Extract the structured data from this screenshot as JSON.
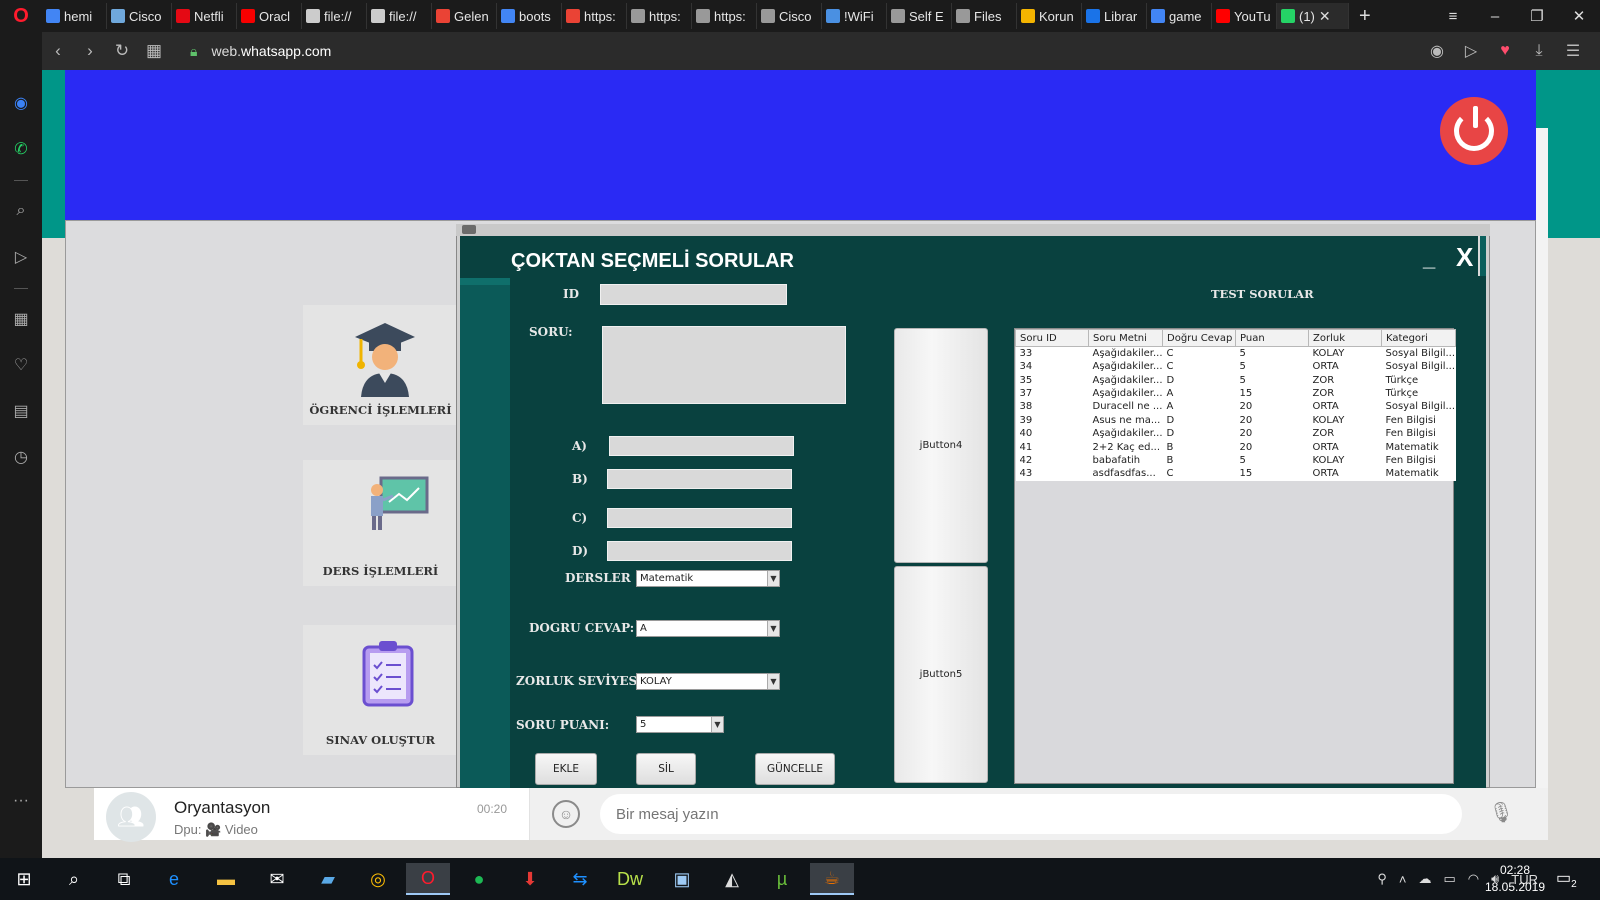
{
  "browser": {
    "tabs": [
      {
        "label": "hemi",
        "color": "#4285f4"
      },
      {
        "label": "Cisco",
        "color": "#6fa8dc"
      },
      {
        "label": "Netfli",
        "color": "#e50914"
      },
      {
        "label": "Oracl",
        "color": "#f80000"
      },
      {
        "label": "file://",
        "color": "#cccccc"
      },
      {
        "label": "file://",
        "color": "#cccccc"
      },
      {
        "label": "Gelen",
        "color": "#ea4335"
      },
      {
        "label": "boots",
        "color": "#4285f4"
      },
      {
        "label": "https:",
        "color": "#ea4335"
      },
      {
        "label": "https:",
        "color": "#999999"
      },
      {
        "label": "https:",
        "color": "#999999"
      },
      {
        "label": "Cisco",
        "color": "#999999"
      },
      {
        "label": "!WiFi",
        "color": "#4a90e2"
      },
      {
        "label": "Self E",
        "color": "#999999"
      },
      {
        "label": "Files",
        "color": "#999999"
      },
      {
        "label": "Korun",
        "color": "#f4b400"
      },
      {
        "label": "Librar",
        "color": "#1a73e8"
      },
      {
        "label": "game",
        "color": "#4285f4"
      },
      {
        "label": "YouTu",
        "color": "#ff0000"
      },
      {
        "label": "(1)",
        "color": "#25d366"
      }
    ],
    "url_prefix": "web.",
    "url_domain": "whatsapp.com"
  },
  "whatsapp": {
    "chat_name": "Oryantasyon",
    "chat_sub": "Dpu: 🎥 Video",
    "chat_time": "00:20",
    "message_placeholder": "Bir mesaj yazın"
  },
  "app": {
    "menu": [
      {
        "label": "ÖGRENCİ İŞLEMLERİ",
        "icon": "graduate-icon"
      },
      {
        "label": "DERS İŞLEMLERİ",
        "icon": "teacher-board-icon"
      },
      {
        "label": "SINAV OLUŞTUR",
        "icon": "clipboard-icon"
      }
    ],
    "frame_title": "ÇOKTAN SEÇMELİ SORULAR",
    "minimize_glyph": "_",
    "close_glyph": "X",
    "labels": {
      "id": "ID",
      "soru": "SORU:",
      "a": "A)",
      "b": "B)",
      "c": "C)",
      "d": "D)",
      "dersler": "DERSLER",
      "dogru_cevap": "DOGRU CEVAP:",
      "zorluk": "ZORLUK SEVİYESİ:",
      "puan": "SORU PUANI:"
    },
    "combos": {
      "dersler": "Matematik",
      "dogru_cevap": "A",
      "zorluk": "KOLAY",
      "puan": "5"
    },
    "buttons": {
      "ekle": "EKLE",
      "sil": "SİL",
      "guncelle": "GÜNCELLE",
      "jbutton4": "jButton4",
      "jbutton5": "jButton5"
    },
    "table_title": "TEST SORULAR",
    "table": {
      "columns": [
        "Soru ID",
        "Soru Metni",
        "Doğru Cevap",
        "Puan",
        "Zorluk",
        "Kategori"
      ],
      "rows": [
        [
          "33",
          "Aşağıdakiler...",
          "C",
          "5",
          "KOLAY",
          "Sosyal Bilgil..."
        ],
        [
          "34",
          "Aşağıdakiler...",
          "C",
          "5",
          "ORTA",
          "Sosyal Bilgil..."
        ],
        [
          "35",
          "Aşağıdakiler...",
          "D",
          "5",
          "ZOR",
          "Türkçe"
        ],
        [
          "37",
          "Aşağıdakiler...",
          "A",
          "15",
          "ZOR",
          "Türkçe"
        ],
        [
          "38",
          "Duracell ne ...",
          "A",
          "20",
          "ORTA",
          "Sosyal Bilgil..."
        ],
        [
          "39",
          "Asus ne ma...",
          "D",
          "20",
          "KOLAY",
          "Fen Bilgisi"
        ],
        [
          "40",
          "Aşağıdakiler...",
          "D",
          "20",
          "ZOR",
          "Fen Bilgisi"
        ],
        [
          "41",
          "2+2 Kaç ed...",
          "B",
          "20",
          "ORTA",
          "Matematik"
        ],
        [
          "42",
          "babafatih",
          "B",
          "5",
          "KOLAY",
          "Fen Bilgisi"
        ],
        [
          "43",
          "asdfasdfas...",
          "C",
          "15",
          "ORTA",
          "Matematik"
        ]
      ]
    }
  },
  "taskbar": {
    "language": "TUR",
    "time": "02:28",
    "date": "18.05.2019",
    "notification_count": "2"
  },
  "colors": {
    "app_header": "#2a2af4",
    "frame_bg": "#09413f",
    "power_button": "#e84545",
    "whatsapp_green": "#009688"
  }
}
